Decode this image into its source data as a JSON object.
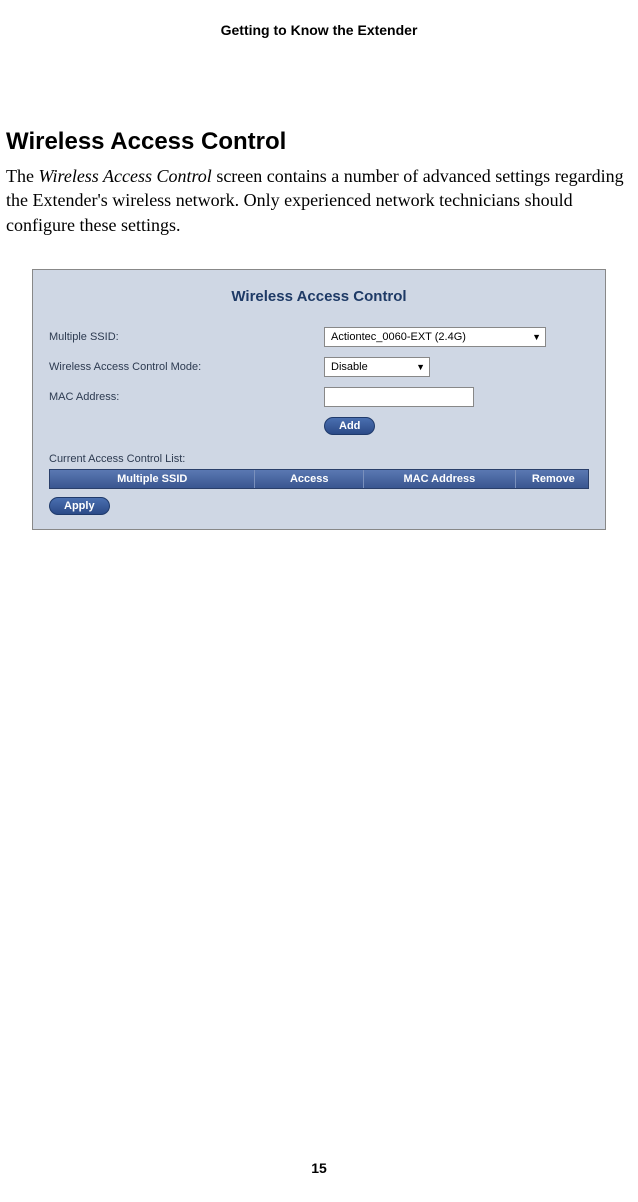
{
  "page": {
    "header": "Getting to Know the Extender",
    "page_number": "15"
  },
  "section": {
    "heading": "Wireless Access Control",
    "paragraph_prefix": "The ",
    "paragraph_italic": "Wireless Access Control",
    "paragraph_suffix": " screen contains a number of advanced settings regarding the Extender's wireless network. Only experienced network technicians should configure these settings."
  },
  "panel": {
    "title": "Wireless Access Control",
    "labels": {
      "ssid": "Multiple SSID:",
      "mode": "Wireless Access Control Mode:",
      "mac": "MAC Address:",
      "list": "Current Access Control List:"
    },
    "values": {
      "ssid": "Actiontec_0060-EXT (2.4G)",
      "mode": "Disable",
      "mac": ""
    },
    "buttons": {
      "add": "Add",
      "apply": "Apply"
    },
    "table_headers": {
      "ssid": "Multiple SSID",
      "access": "Access",
      "mac": "MAC Address",
      "remove": "Remove"
    }
  }
}
